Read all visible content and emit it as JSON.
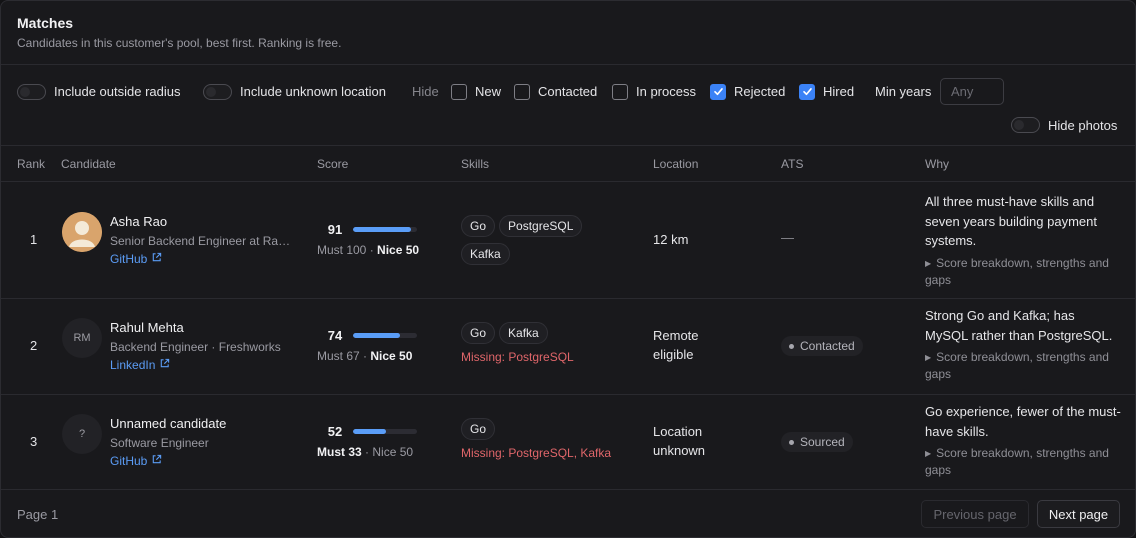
{
  "header": {
    "title": "Matches",
    "subtitle": "Candidates in this customer's pool, best first. Ranking is free."
  },
  "filters": {
    "include_outside_radius": "Include outside radius",
    "include_unknown_location": "Include unknown location",
    "hide_label": "Hide",
    "status_filters": [
      {
        "label": "New",
        "checked": false
      },
      {
        "label": "Contacted",
        "checked": false
      },
      {
        "label": "In process",
        "checked": false
      },
      {
        "label": "Rejected",
        "checked": true
      },
      {
        "label": "Hired",
        "checked": true
      }
    ],
    "min_years_label": "Min years",
    "min_years_placeholder": "Any",
    "hide_photos": "Hide photos",
    "accent_color": "#3b82f6"
  },
  "table": {
    "columns": [
      "Rank",
      "Candidate",
      "Score",
      "Skills",
      "Location",
      "ATS",
      "Why"
    ],
    "rows": [
      {
        "rank": "1",
        "avatar_initials": "",
        "has_photo": true,
        "name": "Asha Rao",
        "title": "Senior Backend Engineer at Razorpay",
        "link": "GitHub",
        "score": "91",
        "score_fraction": 0.91,
        "must": "Must 100",
        "nice": "Nice 50",
        "must_bold": false,
        "skills": [
          "Go",
          "PostgreSQL",
          "Kafka"
        ],
        "missing": "",
        "location": "12 km",
        "ats": "—",
        "ats_is_pill": false,
        "why": "All three must-have skills and seven years building payment systems.",
        "why_more": "Score breakdown, strengths and gaps"
      },
      {
        "rank": "2",
        "avatar_initials": "RM",
        "has_photo": false,
        "name": "Rahul Mehta",
        "title": "Backend Engineer · Freshworks",
        "link": "LinkedIn",
        "score": "74",
        "score_fraction": 0.74,
        "must": "Must 67",
        "nice": "Nice 50",
        "must_bold": false,
        "skills": [
          "Go",
          "Kafka"
        ],
        "missing": "Missing: PostgreSQL",
        "location": "Remote eligible",
        "ats": "Contacted",
        "ats_is_pill": true,
        "why": "Strong Go and Kafka; has MySQL rather than PostgreSQL.",
        "why_more": "Score breakdown, strengths and gaps"
      },
      {
        "rank": "3",
        "avatar_initials": "?",
        "has_photo": false,
        "name": "Unnamed candidate",
        "title": "Software Engineer",
        "link": "GitHub",
        "score": "52",
        "score_fraction": 0.52,
        "must": "Must 33",
        "nice": "Nice 50",
        "must_bold": true,
        "skills": [
          "Go"
        ],
        "missing": "Missing: PostgreSQL, Kafka",
        "location": "Location unknown",
        "ats": "Sourced",
        "ats_is_pill": true,
        "why": "Go experience, fewer of the must-have skills.",
        "why_more": "Score breakdown, strengths and gaps"
      }
    ]
  },
  "footer": {
    "page_label": "Page 1",
    "prev_label": "Previous page",
    "next_label": "Next page"
  }
}
